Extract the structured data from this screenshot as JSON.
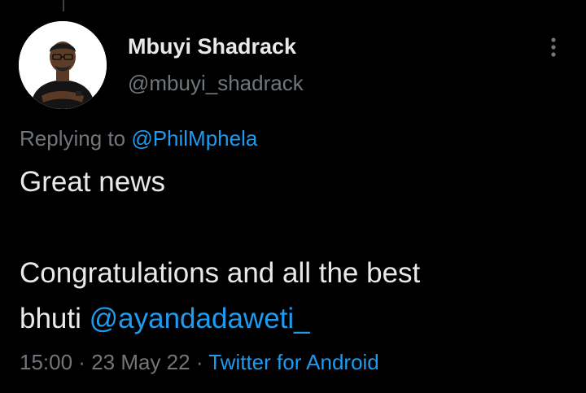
{
  "tweet": {
    "author": {
      "display_name": "Mbuyi Shadrack",
      "handle": "@mbuyi_shadrack"
    },
    "reply": {
      "prefix": "Replying to ",
      "to_handle": "@PhilMphela"
    },
    "body": {
      "line1": "Great news",
      "line3": "Congratulations and all the best",
      "line4_text": "bhuti ",
      "line4_mention": "@ayandadaweti_"
    },
    "meta": {
      "time": "15:00",
      "separator": " · ",
      "date": "23 May 22",
      "source": "Twitter for Android"
    }
  },
  "colors": {
    "background": "#000000",
    "primary_text": "#E7E9EA",
    "secondary_text": "#71767B",
    "link": "#1D9BF0"
  },
  "icons": {
    "more": "more-vertical-icon",
    "avatar": "profile-photo"
  }
}
